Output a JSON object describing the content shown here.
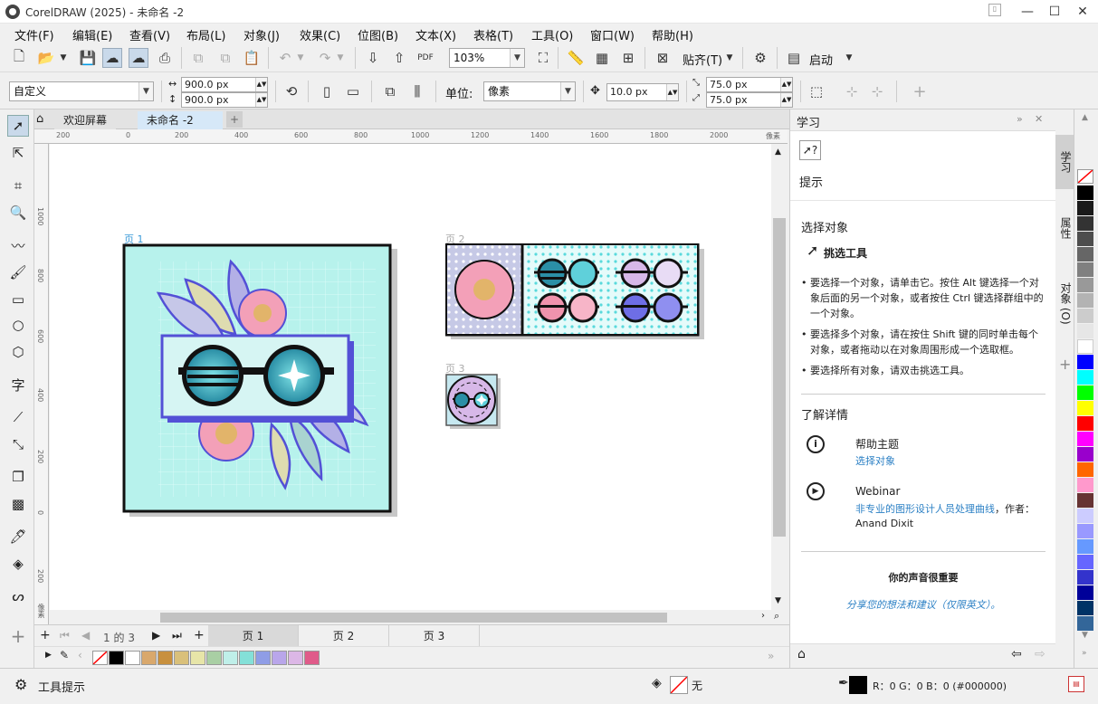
{
  "window": {
    "title": "CorelDRAW (2025) - 未命名 -2",
    "minimize": "—",
    "maximize": "☐",
    "close": "✕"
  },
  "menu": [
    "文件(F)",
    "编辑(E)",
    "查看(V)",
    "布局(L)",
    "对象(J)",
    "效果(C)",
    "位图(B)",
    "文本(X)",
    "表格(T)",
    "工具(O)",
    "窗口(W)",
    "帮助(H)"
  ],
  "toolbar": {
    "zoom": "103%",
    "snap": "贴齐(T)",
    "launch": "启动"
  },
  "property_bar": {
    "preset": "自定义",
    "width": "900.0 px",
    "height": "900.0 px",
    "units_label": "单位:",
    "units": "像素",
    "nudge": "10.0 px",
    "dup_x": "75.0 px",
    "dup_y": "75.0 px"
  },
  "doc_tabs": {
    "welcome": "欢迎屏幕",
    "doc": "未命名 -2"
  },
  "ruler": {
    "h": [
      "200",
      "0",
      "200",
      "400",
      "600",
      "800",
      "1000",
      "1200",
      "1400",
      "1600",
      "1800",
      "2000"
    ],
    "units": "像素",
    "v": [
      "1000",
      "800",
      "600",
      "400",
      "200",
      "0",
      "200"
    ]
  },
  "pages": {
    "p1": "页 1",
    "p2": "页 2",
    "p3": "页 3"
  },
  "page_nav": {
    "current": "1",
    "of": "的",
    "total": "3",
    "tabs": [
      "页 1",
      "页 2",
      "页 3"
    ]
  },
  "docker": {
    "title": "学习",
    "hints_label": "提示",
    "section": "选择对象",
    "tool_name": "挑选工具",
    "bullets": [
      "要选择一个对象，请单击它。按住 Alt 键选择一个对象后面的另一个对象，或者按住 Ctrl 键选择群组中的一个对象。",
      "要选择多个对象，请在按住 Shift 键的同时单击每个对象，或者拖动以在对象周围形成一个选取框。",
      "要选择所有对象，请双击挑选工具。"
    ],
    "more_title": "了解详情",
    "help_title": "帮助主题",
    "help_link": "选择对象",
    "webinar_title": "Webinar",
    "webinar_link": "非专业的图形设计人员处理曲线",
    "webinar_by": "，作者：Anand Dixit",
    "feedback_title": "你的声音很重要",
    "feedback_link": "分享您的想法和建议（仅限英文）。",
    "side_tabs": [
      "学习",
      "属性",
      "对象 (O)"
    ]
  },
  "status": {
    "hint": "工具提示",
    "fill": "无",
    "color": "R：0 G：0 B：0 (#000000)"
  },
  "doc_palette_colors": [
    "#000000",
    "#ffffff",
    "#d9a86c",
    "#c8903e",
    "#d9c07a",
    "#e7e5a8",
    "#a9cfa4",
    "#bfefe9",
    "#84e0d8",
    "#8f9de6",
    "#b9a6ea",
    "#dcb7e6",
    "#e05b8a"
  ],
  "palette_colors": [
    "#000000",
    "#1a1a1a",
    "#333333",
    "#4d4d4d",
    "#666666",
    "#808080",
    "#999999",
    "#b3b3b3",
    "#cccccc",
    "#e6e6e6",
    "#ffffff",
    "#0000ff",
    "#00ffff",
    "#00ff00",
    "#ffff00",
    "#ff0000",
    "#ff00ff",
    "#9900cc",
    "#ff6600",
    "#ff99cc",
    "#663333",
    "#ccccff",
    "#9999ff",
    "#6699ff",
    "#6666ff",
    "#3333cc",
    "#000099",
    "#003366",
    "#336699"
  ]
}
